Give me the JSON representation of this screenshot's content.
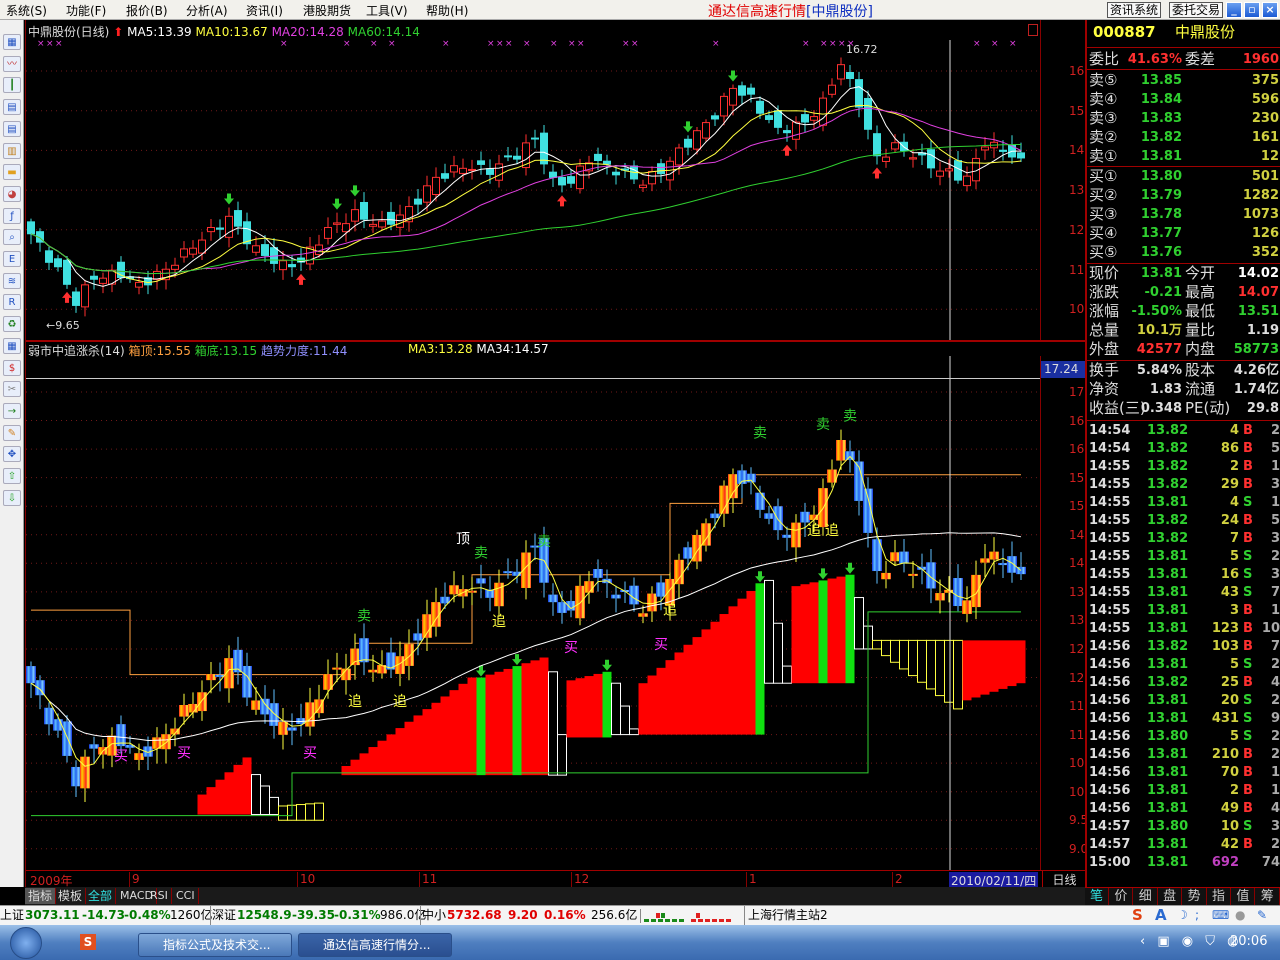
{
  "menu": {
    "items": [
      "系统(S)",
      "功能(F)",
      "报价(B)",
      "分析(A)",
      "资讯(I)",
      "港股期货",
      "工具(V)",
      "帮助(H)"
    ],
    "title_app": "通达信高速行情",
    "title_stock": "[中鼎股份]",
    "btn_news": "资讯系统",
    "btn_trade": "委托交易"
  },
  "top_chart": {
    "stock": "中鼎股份(日线)",
    "ma5": "MA5:13.39",
    "ma10": "MA10:13.67",
    "ma20": "MA20:14.28",
    "ma60": "MA60:14.14",
    "yticks": [
      "16.00",
      "15.00",
      "14.00",
      "13.00",
      "12.00",
      "11.00",
      "10.00"
    ],
    "low_label": "←9.65",
    "high_label": "16.72"
  },
  "lower_chart": {
    "name": "弱市中追涨杀(14)",
    "box_top": "箱顶:15.55",
    "box_bottom": "箱底:13.15",
    "trend": "趋势力度:11.44",
    "ma3": "MA3:13.28",
    "ma34": "MA34:14.57",
    "cursor_value": "17.24",
    "yticks": [
      "17.00",
      "16.50",
      "16.00",
      "15.50",
      "15.00",
      "14.50",
      "14.00",
      "13.50",
      "13.00",
      "12.50",
      "12.00",
      "11.50",
      "11.00",
      "10.50",
      "10.00",
      "9.50",
      "9.00"
    ]
  },
  "time_axis": {
    "labels": [
      "2009年",
      "9",
      "10",
      "11",
      "12",
      "1",
      "2"
    ],
    "cursor_date": "2010/02/11/四",
    "period": "日线"
  },
  "bottom_tabs": [
    "指标",
    "模板",
    "全部",
    "MACD",
    "RSI",
    "CCI"
  ],
  "right_tabs": [
    "笔",
    "价",
    "细",
    "盘",
    "势",
    "指",
    "值",
    "筹"
  ],
  "quote": {
    "code": "000887",
    "name": "中鼎股份",
    "weibi_label": "委比",
    "weibi": "41.63%",
    "weicha_label": "委差",
    "weicha": "1960",
    "sells": [
      {
        "label": "卖⑤",
        "price": "13.85",
        "vol": "375"
      },
      {
        "label": "卖④",
        "price": "13.84",
        "vol": "596"
      },
      {
        "label": "卖③",
        "price": "13.83",
        "vol": "230"
      },
      {
        "label": "卖②",
        "price": "13.82",
        "vol": "161"
      },
      {
        "label": "卖①",
        "price": "13.81",
        "vol": "12"
      }
    ],
    "buys": [
      {
        "label": "买①",
        "price": "13.80",
        "vol": "501"
      },
      {
        "label": "买②",
        "price": "13.79",
        "vol": "1282"
      },
      {
        "label": "买③",
        "price": "13.78",
        "vol": "1073"
      },
      {
        "label": "买④",
        "price": "13.77",
        "vol": "126"
      },
      {
        "label": "买⑤",
        "price": "13.76",
        "vol": "352"
      }
    ],
    "stats": [
      {
        "l1": "现价",
        "v1": "13.81",
        "c1": "#30d030",
        "l2": "今开",
        "v2": "14.02",
        "c2": "#ffffff"
      },
      {
        "l1": "涨跌",
        "v1": "-0.21",
        "c1": "#30d030",
        "l2": "最高",
        "v2": "14.07",
        "c2": "#ff3030"
      },
      {
        "l1": "涨幅",
        "v1": "-1.50%",
        "c1": "#30d030",
        "l2": "最低",
        "v2": "13.51",
        "c2": "#30d030"
      },
      {
        "l1": "总量",
        "v1": "10.1万",
        "c1": "#d0d040",
        "l2": "量比",
        "v2": "1.19",
        "c2": "#dddddd"
      },
      {
        "l1": "外盘",
        "v1": "42577",
        "c1": "#ff3030",
        "l2": "内盘",
        "v2": "58773",
        "c2": "#30d030"
      }
    ],
    "fin": [
      {
        "l1": "换手",
        "v1": "5.84%",
        "l2": "股本",
        "v2": "4.26亿"
      },
      {
        "l1": "净资",
        "v1": "1.83",
        "l2": "流通",
        "v2": "1.74亿"
      },
      {
        "l1": "收益(三)",
        "v1": "0.348",
        "l2": "PE(动)",
        "v2": "29.8"
      }
    ]
  },
  "ticks": [
    [
      "14:54",
      "13.82",
      "4",
      "B",
      "2"
    ],
    [
      "14:54",
      "13.82",
      "86",
      "B",
      "5"
    ],
    [
      "14:55",
      "13.82",
      "2",
      "B",
      "1"
    ],
    [
      "14:55",
      "13.82",
      "29",
      "B",
      "3"
    ],
    [
      "14:55",
      "13.81",
      "4",
      "S",
      "1"
    ],
    [
      "14:55",
      "13.82",
      "24",
      "B",
      "5"
    ],
    [
      "14:55",
      "13.82",
      "7",
      "B",
      "3"
    ],
    [
      "14:55",
      "13.81",
      "5",
      "S",
      "2"
    ],
    [
      "14:55",
      "13.81",
      "16",
      "S",
      "3"
    ],
    [
      "14:55",
      "13.81",
      "43",
      "S",
      "7"
    ],
    [
      "14:55",
      "13.81",
      "3",
      "B",
      "1"
    ],
    [
      "14:55",
      "13.81",
      "123",
      "B",
      "10"
    ],
    [
      "14:56",
      "13.82",
      "103",
      "B",
      "7"
    ],
    [
      "14:56",
      "13.81",
      "5",
      "S",
      "2"
    ],
    [
      "14:56",
      "13.82",
      "25",
      "B",
      "4"
    ],
    [
      "14:56",
      "13.81",
      "20",
      "S",
      "2"
    ],
    [
      "14:56",
      "13.81",
      "431",
      "S",
      "9"
    ],
    [
      "14:56",
      "13.80",
      "5",
      "S",
      "2"
    ],
    [
      "14:56",
      "13.81",
      "210",
      "B",
      "2"
    ],
    [
      "14:56",
      "13.81",
      "70",
      "B",
      "1"
    ],
    [
      "14:56",
      "13.81",
      "2",
      "B",
      "1"
    ],
    [
      "14:56",
      "13.81",
      "49",
      "B",
      "4"
    ],
    [
      "14:57",
      "13.80",
      "10",
      "S",
      "3"
    ],
    [
      "14:57",
      "13.81",
      "42",
      "B",
      "2"
    ],
    [
      "15:00",
      "13.81",
      "692",
      "",
      "74"
    ]
  ],
  "status": {
    "sh_label": "上证",
    "sh": "3073.11",
    "sh_chg": "-14.73",
    "sh_pct": "-0.48%",
    "sh_amt": "1260亿",
    "sz_label": "深证",
    "sz": "12548.9",
    "sz_chg": "-39.35",
    "sz_pct": "-0.31%",
    "sz_amt": "986.0亿",
    "zx_label": "中小",
    "zx": "5732.68",
    "zx_chg": "9.20",
    "zx_pct": "0.16%",
    "zx_amt": "256.6亿",
    "server": "上海行情主站2"
  },
  "taskbar": {
    "task1": "指标公式及技术交...",
    "task2": "通达信高速行情分...",
    "clock": "20:06"
  },
  "colors": {
    "up": "#ff3030",
    "down": "#40e0e0",
    "ma5": "#ffffff",
    "ma10": "#ffff40",
    "ma20": "#e040e0",
    "ma60": "#30d030",
    "axis": "#d02020"
  },
  "chart_data": {
    "type": "candlestick",
    "title": "中鼎股份(日线)",
    "days": 111,
    "close_keypoints": [
      [
        0,
        11.9
      ],
      [
        3,
        11.0
      ],
      [
        5,
        10.2
      ],
      [
        7,
        10.8
      ],
      [
        10,
        10.9
      ],
      [
        12,
        10.6
      ],
      [
        15,
        11.0
      ],
      [
        18,
        11.6
      ],
      [
        22,
        12.3
      ],
      [
        25,
        11.5
      ],
      [
        28,
        11.1
      ],
      [
        30,
        11.2
      ],
      [
        33,
        12.0
      ],
      [
        36,
        12.4
      ],
      [
        39,
        12.1
      ],
      [
        42,
        12.5
      ],
      [
        45,
        13.3
      ],
      [
        48,
        13.6
      ],
      [
        51,
        13.5
      ],
      [
        54,
        13.9
      ],
      [
        56,
        14.3
      ],
      [
        58,
        13.2
      ],
      [
        60,
        13.2
      ],
      [
        62,
        13.8
      ],
      [
        65,
        13.5
      ],
      [
        68,
        13.2
      ],
      [
        70,
        13.5
      ],
      [
        73,
        14.2
      ],
      [
        76,
        14.9
      ],
      [
        78,
        15.6
      ],
      [
        80,
        15.3
      ],
      [
        83,
        14.5
      ],
      [
        86,
        14.7
      ],
      [
        88,
        15.2
      ],
      [
        90,
        16.2
      ],
      [
        92,
        15.2
      ],
      [
        94,
        13.8
      ],
      [
        96,
        14.1
      ],
      [
        98,
        13.9
      ],
      [
        101,
        13.5
      ],
      [
        104,
        13.3
      ],
      [
        106,
        14.2
      ],
      [
        108,
        14.0
      ],
      [
        110,
        13.81
      ]
    ],
    "top_ylim": [
      9.3,
      17.2
    ],
    "lower_ylim": [
      8.8,
      17.5
    ],
    "top_signals": [
      {
        "day": 22,
        "type": "sell"
      },
      {
        "day": 34,
        "type": "sell"
      },
      {
        "day": 36,
        "type": "sell"
      },
      {
        "day": 73,
        "type": "sell"
      },
      {
        "day": 78,
        "type": "sell"
      },
      {
        "day": 4,
        "type": "buy"
      },
      {
        "day": 30,
        "type": "buy"
      },
      {
        "day": 59,
        "type": "buy"
      },
      {
        "day": 84,
        "type": "buy"
      },
      {
        "day": 94,
        "type": "buy"
      }
    ],
    "top_markers": [
      1,
      2,
      3,
      28,
      35,
      38,
      40,
      46,
      51,
      52,
      53,
      55,
      58,
      60,
      61,
      66,
      67,
      76,
      86,
      88,
      89,
      90,
      91,
      105,
      107,
      109
    ],
    "box_top_steps": [
      [
        0,
        13.18
      ],
      [
        11,
        12.05
      ],
      [
        36,
        12.6
      ],
      [
        49,
        13.8
      ],
      [
        71,
        15.05
      ],
      [
        79,
        15.55
      ],
      [
        110,
        15.55
      ]
    ],
    "box_bottom_steps": [
      [
        0,
        9.58
      ],
      [
        29,
        10.33
      ],
      [
        60,
        10.33
      ],
      [
        93,
        13.15
      ],
      [
        110,
        13.15
      ]
    ],
    "panel_bars": [
      {
        "from": 19,
        "to": 24,
        "base": 9.6,
        "top0": 9.95,
        "top1": 10.6,
        "style": "red"
      },
      {
        "from": 25,
        "to": 27,
        "base": 9.6,
        "top0": 10.3,
        "top1": 9.9,
        "style": "white"
      },
      {
        "from": 28,
        "to": 32,
        "base": 9.5,
        "top0": 9.75,
        "top1": 9.8,
        "style": "yellow"
      },
      {
        "from": 35,
        "to": 49,
        "base": 10.29,
        "top0": 10.45,
        "top1": 12.0,
        "style": "red"
      },
      {
        "from": 50,
        "to": 57,
        "base": 10.29,
        "top0": 12.0,
        "top1": 12.35,
        "style": "red",
        "green": [
          50,
          54
        ]
      },
      {
        "from": 58,
        "to": 59,
        "base": 10.29,
        "top0": 12.1,
        "top1": 11.0,
        "style": "white"
      },
      {
        "from": 60,
        "to": 64,
        "base": 10.95,
        "top0": 11.95,
        "top1": 12.1,
        "style": "red",
        "green": [
          64
        ]
      },
      {
        "from": 65,
        "to": 67,
        "base": 11.0,
        "top0": 11.9,
        "top1": 11.1,
        "style": "white"
      },
      {
        "from": 68,
        "to": 81,
        "base": 11.0,
        "top0": 11.9,
        "top1": 13.65,
        "style": "red",
        "green": [
          81
        ]
      },
      {
        "from": 82,
        "to": 84,
        "base": 11.9,
        "top0": 13.7,
        "top1": 12.2,
        "style": "white"
      },
      {
        "from": 85,
        "to": 91,
        "base": 11.9,
        "top0": 13.6,
        "top1": 13.8,
        "style": "red",
        "green": [
          88,
          91
        ]
      },
      {
        "from": 92,
        "to": 93,
        "base": 12.5,
        "top0": 13.4,
        "top1": 12.9,
        "style": "white"
      },
      {
        "from": 94,
        "to": 103,
        "base": 12.65,
        "top0": 12.5,
        "top1": 11.45,
        "style": "yellow",
        "invert": true
      },
      {
        "from": 104,
        "to": 110,
        "base": 12.65,
        "top0": 11.6,
        "top1": 11.9,
        "style": "redbar",
        "invert": true
      }
    ],
    "lower_signals": [
      {
        "day": 10,
        "price": 10.55,
        "text": "买",
        "color": "#ff30ff"
      },
      {
        "day": 17,
        "price": 10.6,
        "text": "买",
        "color": "#ff30ff"
      },
      {
        "day": 31,
        "price": 10.6,
        "text": "买",
        "color": "#ff30ff"
      },
      {
        "day": 37,
        "price": 13.0,
        "text": "卖",
        "color": "#30d030"
      },
      {
        "day": 36,
        "price": 11.5,
        "text": "追",
        "color": "#ffff40"
      },
      {
        "day": 41,
        "price": 11.5,
        "text": "追",
        "color": "#ffff40"
      },
      {
        "day": 48,
        "price": 14.35,
        "text": "顶",
        "color": "#ffffff"
      },
      {
        "day": 50,
        "price": 14.1,
        "text": "卖",
        "color": "#30d030"
      },
      {
        "day": 52,
        "price": 12.9,
        "text": "追",
        "color": "#ffff40"
      },
      {
        "day": 57,
        "price": 14.3,
        "text": "卖",
        "color": "#30d030"
      },
      {
        "day": 60,
        "price": 12.45,
        "text": "买",
        "color": "#ff30ff"
      },
      {
        "day": 70,
        "price": 12.5,
        "text": "买",
        "color": "#ff30ff"
      },
      {
        "day": 71,
        "price": 13.1,
        "text": "追",
        "color": "#ffff40"
      },
      {
        "day": 81,
        "price": 16.2,
        "text": "卖",
        "color": "#30d030"
      },
      {
        "day": 88,
        "price": 16.35,
        "text": "卖",
        "color": "#30d030"
      },
      {
        "day": 91,
        "price": 16.5,
        "text": "卖",
        "color": "#30d030"
      },
      {
        "day": 87,
        "price": 14.5,
        "text": "追",
        "color": "#ffff40"
      },
      {
        "day": 89,
        "price": 14.5,
        "text": "追",
        "color": "#ffff40"
      }
    ]
  }
}
